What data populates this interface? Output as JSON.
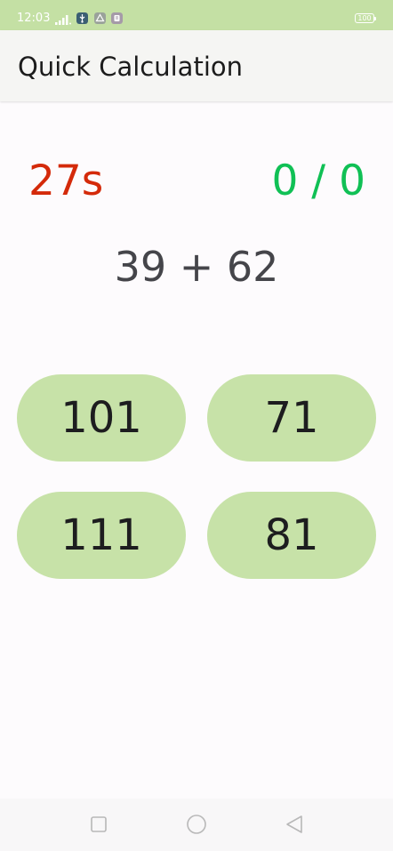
{
  "status_bar": {
    "time": "12:03",
    "battery": "100",
    "icons": [
      "signal-icon",
      "usb-icon",
      "drive-icon",
      "app-icon"
    ],
    "background": "#c4e0a4"
  },
  "app_bar": {
    "title": "Quick Calculation"
  },
  "game": {
    "timer": "27s",
    "score": "0 / 0",
    "question": "39 + 62",
    "answers": [
      "101",
      "71",
      "111",
      "81"
    ]
  },
  "colors": {
    "timer": "#d42a0a",
    "score": "#10c055",
    "answer_button": "#c7e2a8"
  },
  "nav_bar": {
    "icons": [
      "recent-apps-icon",
      "home-icon",
      "back-icon"
    ]
  }
}
